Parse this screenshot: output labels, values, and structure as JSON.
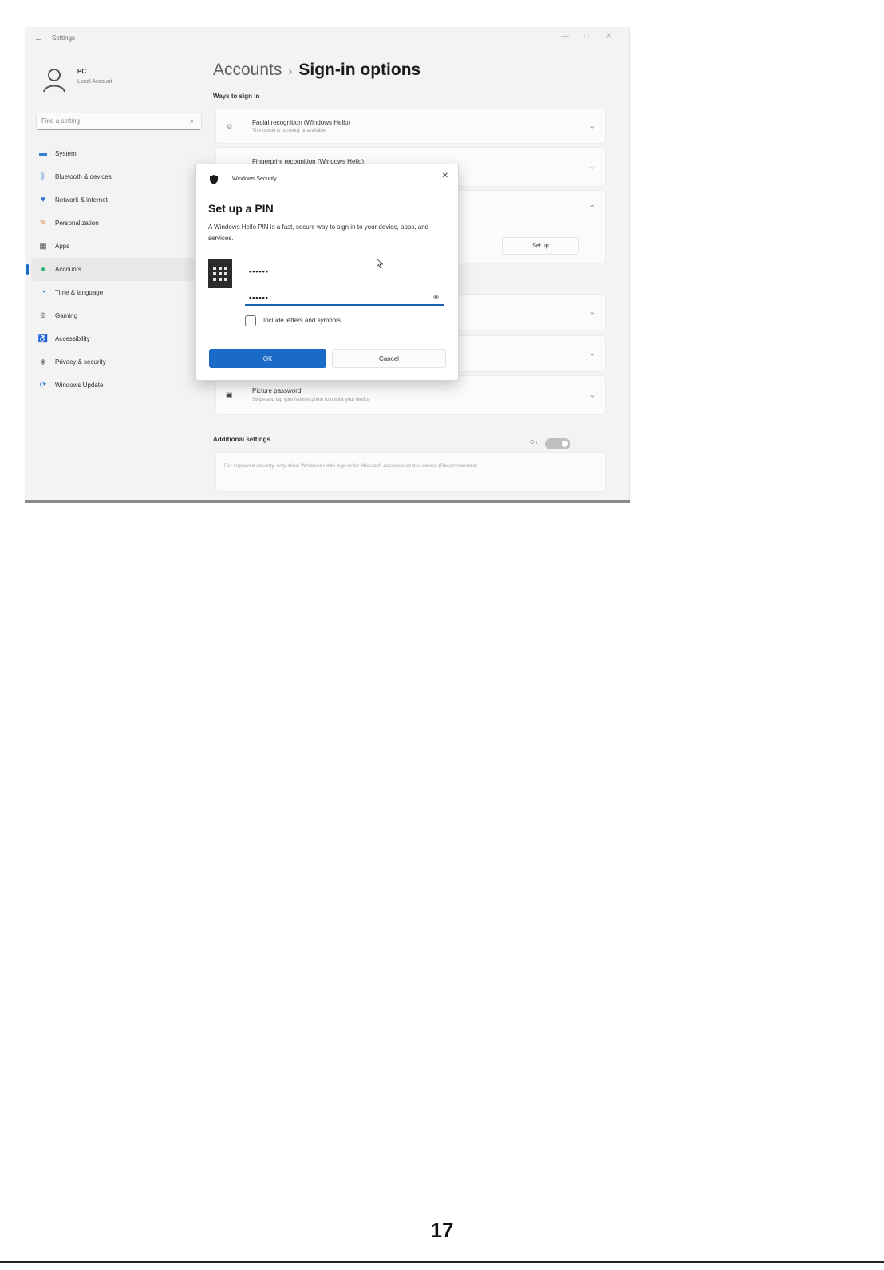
{
  "window": {
    "title": "Settings",
    "back": "←",
    "controls": [
      "—",
      "□",
      "✕"
    ]
  },
  "profile": {
    "name": "PC",
    "account": "Local Account"
  },
  "search": {
    "placeholder": "Find a setting"
  },
  "nav": [
    {
      "label": "System",
      "icon": "monitor-icon",
      "glyph": "▬",
      "color": "#3b7dd8"
    },
    {
      "label": "Bluetooth & devices",
      "icon": "bluetooth-icon",
      "glyph": "ᛒ",
      "color": "#1f6fd1"
    },
    {
      "label": "Network & internet",
      "icon": "wifi-icon",
      "glyph": "▼",
      "color": "#2a74cf"
    },
    {
      "label": "Personalization",
      "icon": "brush-icon",
      "glyph": "✎",
      "color": "#d08a3a"
    },
    {
      "label": "Apps",
      "icon": "apps-icon",
      "glyph": "▦",
      "color": "#555555"
    },
    {
      "label": "Accounts",
      "icon": "person-icon",
      "glyph": "●",
      "color": "#2bb673",
      "active": true
    },
    {
      "label": "Time & language",
      "icon": "globe-clock-icon",
      "glyph": "◔",
      "color": "#2a74cf"
    },
    {
      "label": "Gaming",
      "icon": "gamepad-icon",
      "glyph": "⊕",
      "color": "#666666"
    },
    {
      "label": "Accessibility",
      "icon": "accessibility-icon",
      "glyph": "♿",
      "color": "#2a74cf"
    },
    {
      "label": "Privacy & security",
      "icon": "shield-icon",
      "glyph": "◈",
      "color": "#666666"
    },
    {
      "label": "Windows Update",
      "icon": "update-icon",
      "glyph": "⟳",
      "color": "#2a74cf"
    }
  ],
  "breadcrumb": {
    "parent": "Accounts",
    "separator": "›",
    "current": "Sign-in options"
  },
  "ways_title": "Ways to sign in",
  "cards": [
    {
      "title": "Facial recognition (Windows Hello)",
      "subtitle": "This option is currently unavailable",
      "icon": "face-icon",
      "glyph": "☺"
    },
    {
      "title": "Fingerprint recognition (Windows Hello)",
      "subtitle": "",
      "icon": "fingerprint-icon",
      "glyph": "◉"
    },
    {
      "title": "",
      "subtitle": "",
      "icon": "",
      "glyph": ""
    },
    {
      "title": "",
      "subtitle": "",
      "icon": "",
      "glyph": ""
    },
    {
      "title": "",
      "subtitle": "",
      "icon": "",
      "glyph": ""
    },
    {
      "title": "Picture password",
      "subtitle": "Swipe and tap your favorite photo to unlock your device",
      "icon": "picture-icon",
      "glyph": "▣"
    }
  ],
  "setup_button": "Set up",
  "additional_title": "Additional settings",
  "additional_text": "For improved security, only allow Windows Hello sign-in for Microsoft accounts on this device (Recommended)",
  "toggle": {
    "state_label": "On",
    "on": true
  },
  "dialog": {
    "app": "Windows Security",
    "close": "✕",
    "title": "Set up a PIN",
    "description": "A Windows Hello PIN is a fast, secure way to sign in to your device, apps, and services.",
    "new_pin": "••••••",
    "confirm_pin": "••••••",
    "reveal": "◉",
    "checkbox_label": "Include letters and symbols",
    "ok": "OK",
    "cancel": "Cancel"
  },
  "page_number": "17",
  "colors": {
    "accent": "#1a6ac7",
    "background": "#f3f3f3",
    "card": "#fbfbfb"
  }
}
